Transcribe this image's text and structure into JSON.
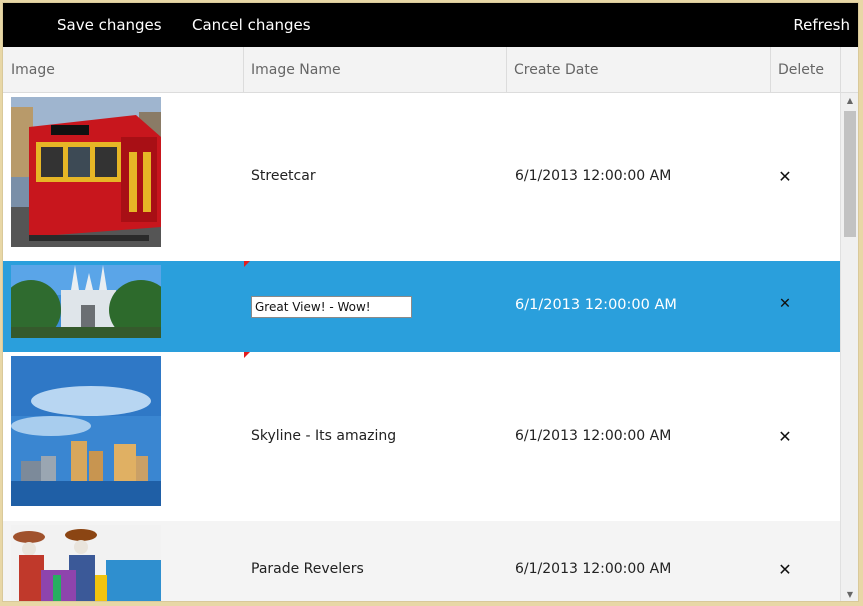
{
  "toolbar": {
    "save_label": "Save changes",
    "cancel_label": "Cancel changes",
    "refresh_label": "Refresh"
  },
  "columns": [
    "Image",
    "Image Name",
    "Create Date",
    "Delete"
  ],
  "rows": [
    {
      "image": "streetcar-photo",
      "name": "Streetcar",
      "date": "6/1/2013 12:00:00 AM",
      "delete": "✕"
    },
    {
      "image": "cathedral-photo",
      "name": "Great View! - Wow!",
      "date": "6/1/2013 12:00:00 AM",
      "delete": "✕",
      "editing": true,
      "selected": true
    },
    {
      "image": "skyline-photo",
      "name": "Skyline - Its amazing",
      "date": "6/1/2013 12:00:00 AM",
      "delete": "✕"
    },
    {
      "image": "parade-photo",
      "name": "Parade Revelers",
      "date": "6/1/2013 12:00:00 AM",
      "delete": "✕"
    }
  ],
  "colors": {
    "toolbar_bg": "#000000",
    "selected_row": "#2a9fdc",
    "changed_marker": "#e21d1d"
  },
  "scrollbar": {
    "up_icon": "scroll-up-arrow-icon",
    "down_icon": "scroll-down-arrow-icon"
  }
}
